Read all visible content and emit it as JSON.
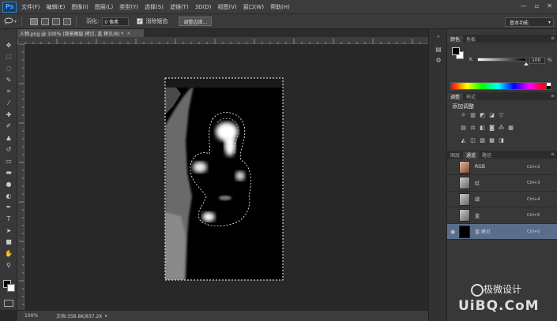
{
  "app": {
    "logo": "Ps"
  },
  "menu": [
    "文件(F)",
    "编辑(E)",
    "图像(I)",
    "图层(L)",
    "类型(Y)",
    "选择(S)",
    "滤镜(T)",
    "3D(D)",
    "视图(V)",
    "窗口(W)",
    "帮助(H)"
  ],
  "window_controls": {
    "minimize": "—",
    "maximize": "▫",
    "close": "✕"
  },
  "options_bar": {
    "tool_icon": "lasso-icon",
    "feather_label": "羽化:",
    "feather_value": "0 像素",
    "antialias_label": "消除锯齿",
    "antialias_checked": true,
    "refine_edge_label": "调整边缘...",
    "workspace": "基本功能"
  },
  "document": {
    "tab_title": "人物.png @ 100% (背景图层 拷贝, 蓝 拷贝/8) *",
    "zoom": "100%",
    "doc_info": "文档:358.8K/837.2K"
  },
  "tools": [
    "move-icon",
    "marquee-icon",
    "lasso-icon",
    "quick-select-icon",
    "crop-icon",
    "eyedropper-icon",
    "healing-icon",
    "brush-icon",
    "clone-stamp-icon",
    "history-brush-icon",
    "eraser-icon",
    "gradient-icon",
    "blur-icon",
    "dodge-icon",
    "pen-icon",
    "type-icon",
    "path-select-icon",
    "rectangle-icon",
    "hand-icon",
    "zoom-icon"
  ],
  "color_panel": {
    "tabs": [
      "颜色",
      "色板"
    ],
    "channel_label": "K",
    "k_value": "100",
    "k_unit": "%",
    "k_level": 1.0,
    "foreground": "#000000",
    "background": "#ffffff"
  },
  "adjustments_panel": {
    "tabs": [
      "调整",
      "样式"
    ],
    "title": "添加调整",
    "row1": [
      "brightness-icon",
      "levels-icon",
      "curves-icon",
      "exposure-icon",
      "vibrance-icon"
    ],
    "row2": [
      "hue-sat-icon",
      "color-balance-icon",
      "black-white-icon",
      "photo-filter-icon",
      "channel-mixer-icon",
      "color-lookup-icon"
    ],
    "row3": [
      "invert-icon",
      "posterize-icon",
      "threshold-icon",
      "gradient-map-icon",
      "selective-color-icon"
    ]
  },
  "channels_panel": {
    "tabs": [
      "图层",
      "通道",
      "路径"
    ],
    "rows": [
      {
        "name": "RGB",
        "shortcut": "Ctrl+2",
        "visible": false,
        "selected": false
      },
      {
        "name": "红",
        "shortcut": "Ctrl+3",
        "visible": false,
        "selected": false
      },
      {
        "name": "绿",
        "shortcut": "Ctrl+4",
        "visible": false,
        "selected": false
      },
      {
        "name": "蓝",
        "shortcut": "Ctrl+5",
        "visible": false,
        "selected": false
      },
      {
        "name": "蓝 拷贝",
        "shortcut": "Ctrl+6",
        "visible": true,
        "selected": true
      }
    ]
  },
  "watermark": {
    "brand": "极微设计",
    "site": "UiBQ.CoM"
  }
}
